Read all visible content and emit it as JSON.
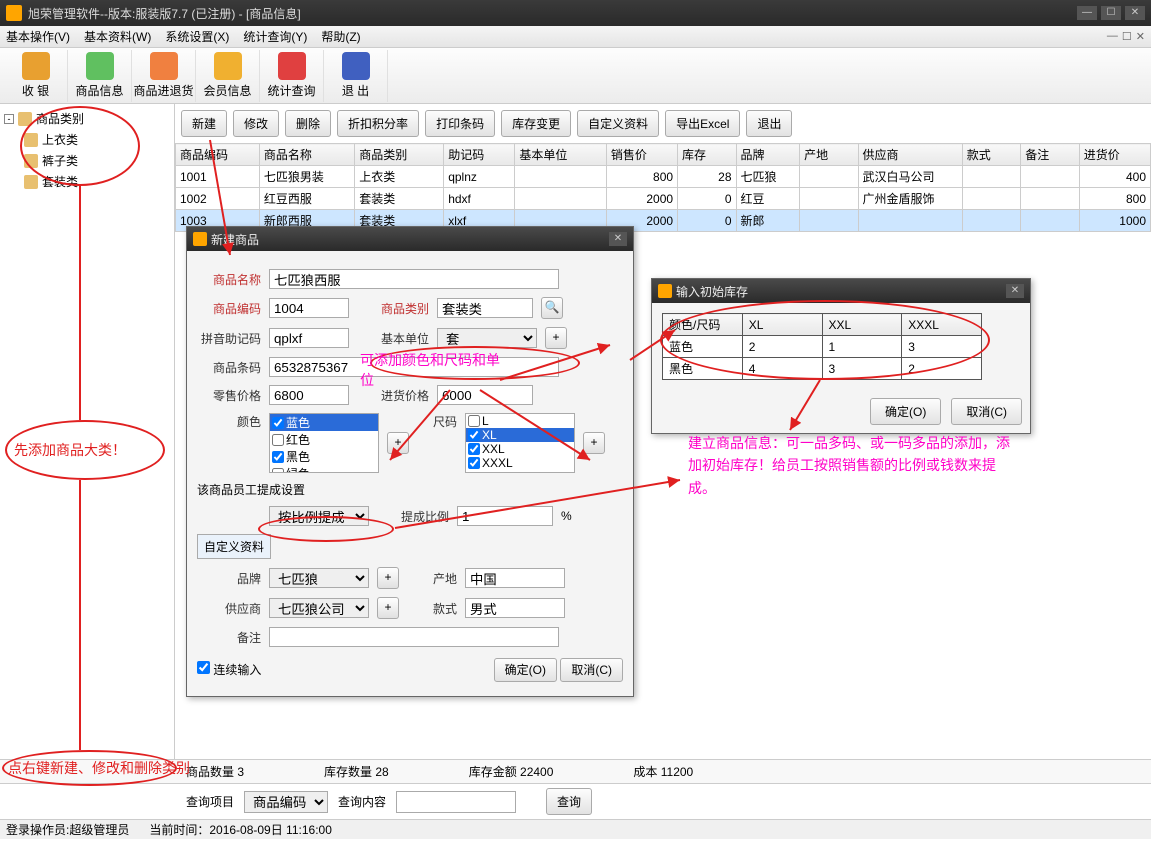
{
  "window": {
    "title": "旭荣管理软件--版本:服装版7.7 (已注册) - [商品信息]"
  },
  "menu": {
    "items": [
      "基本操作(V)",
      "基本资料(W)",
      "系统设置(X)",
      "统计查询(Y)",
      "帮助(Z)"
    ]
  },
  "toolbar": {
    "items": [
      "收 银",
      "商品信息",
      "商品进退货",
      "会员信息",
      "统计查询",
      "退 出"
    ]
  },
  "tree": {
    "root": "商品类别",
    "children": [
      "上衣类",
      "裤子类",
      "套装类"
    ]
  },
  "buttons": [
    "新建",
    "修改",
    "删除",
    "折扣积分率",
    "打印条码",
    "库存变更",
    "自定义资料",
    "导出Excel",
    "退出"
  ],
  "grid": {
    "headers": [
      "商品编码",
      "商品名称",
      "商品类别",
      "助记码",
      "基本单位",
      "销售价",
      "库存",
      "品牌",
      "产地",
      "供应商",
      "款式",
      "备注",
      "进货价"
    ],
    "rows": [
      [
        "1001",
        "七匹狼男装",
        "上衣类",
        "qplnz",
        "",
        "800",
        "28",
        "七匹狼",
        "",
        "武汉白马公司",
        "",
        "",
        "400"
      ],
      [
        "1002",
        "红豆西服",
        "套装类",
        "hdxf",
        "",
        "2000",
        "0",
        "红豆",
        "",
        "广州金盾服饰",
        "",
        "",
        "800"
      ],
      [
        "1003",
        "新郎西服",
        "套装类",
        "xlxf",
        "",
        "2000",
        "0",
        "新郎",
        "",
        "",
        "",
        "",
        "1000"
      ]
    ]
  },
  "dlg_new": {
    "title": "新建商品",
    "labels": {
      "name": "商品名称",
      "code": "商品编码",
      "cat": "商品类别",
      "py": "拼音助记码",
      "unit": "基本单位",
      "barcode": "商品条码",
      "retail": "零售价格",
      "purchase": "进货价格",
      "color": "颜色",
      "size": "尺码",
      "commission": "该商品员工提成设置",
      "ratio": "提成比例",
      "custom": "自定义资料",
      "brand": "品牌",
      "origin": "产地",
      "supplier": "供应商",
      "style": "款式",
      "remark": "备注",
      "cont": "连续输入",
      "ok": "确定(O)",
      "cancel": "取消(C)"
    },
    "values": {
      "name": "七匹狼西服",
      "code": "1004",
      "cat": "套装类",
      "py": "qplxf",
      "unit": "套",
      "barcode": "6532875367",
      "retail": "6800",
      "purchase": "6000",
      "commission_mode": "按比例提成",
      "ratio": "1",
      "brand": "七匹狼",
      "origin": "中国",
      "supplier": "七匹狼公司",
      "style": "男式",
      "remark": ""
    },
    "colors": [
      "蓝色",
      "红色",
      "黑色",
      "绿色"
    ],
    "sizes": [
      "L",
      "XL",
      "XXL",
      "XXXL"
    ]
  },
  "dlg_stock": {
    "title": "输入初始库存",
    "hdr": "颜色/尺码",
    "cols": [
      "XL",
      "XXL",
      "XXXL"
    ],
    "rows": [
      {
        "k": "蓝色",
        "v": [
          "2",
          "1",
          "3"
        ]
      },
      {
        "k": "黑色",
        "v": [
          "4",
          "3",
          "2"
        ]
      }
    ],
    "ok": "确定(O)",
    "cancel": "取消(C)"
  },
  "summary": {
    "count": "商品数量 3",
    "stockqty": "库存数量 28",
    "stockval": "库存金额 22400",
    "cost": "成本 11200"
  },
  "query": {
    "item_lbl": "查询项目",
    "item_val": "商品编码",
    "content_lbl": "查询内容",
    "content_val": "",
    "btn": "查询"
  },
  "status": {
    "user": "登录操作员:超级管理员",
    "time": "当前时间：2016-08-09日 11:16:00"
  },
  "anno": {
    "a1": "先添加商品大类！",
    "a2": "可添加颜色和尺码和单位",
    "a3": "建立商品信息：可一品多码、或一码多品的添加，添加初始库存！给员工按照销售额的比例或钱数来提成。",
    "a4": "点右键新建、修改和删除类别"
  }
}
